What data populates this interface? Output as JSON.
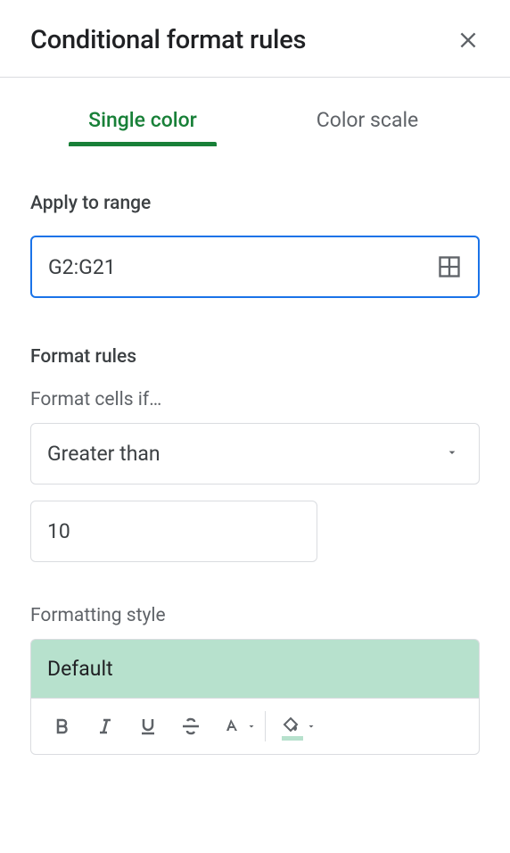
{
  "header": {
    "title": "Conditional format rules"
  },
  "tabs": {
    "single_color": "Single color",
    "color_scale": "Color scale"
  },
  "range": {
    "label": "Apply to range",
    "value": "G2:G21"
  },
  "rules": {
    "label": "Format rules",
    "condition_label": "Format cells if…",
    "condition": "Greater than",
    "value": "10"
  },
  "style": {
    "label": "Formatting style",
    "preview": "Default"
  }
}
